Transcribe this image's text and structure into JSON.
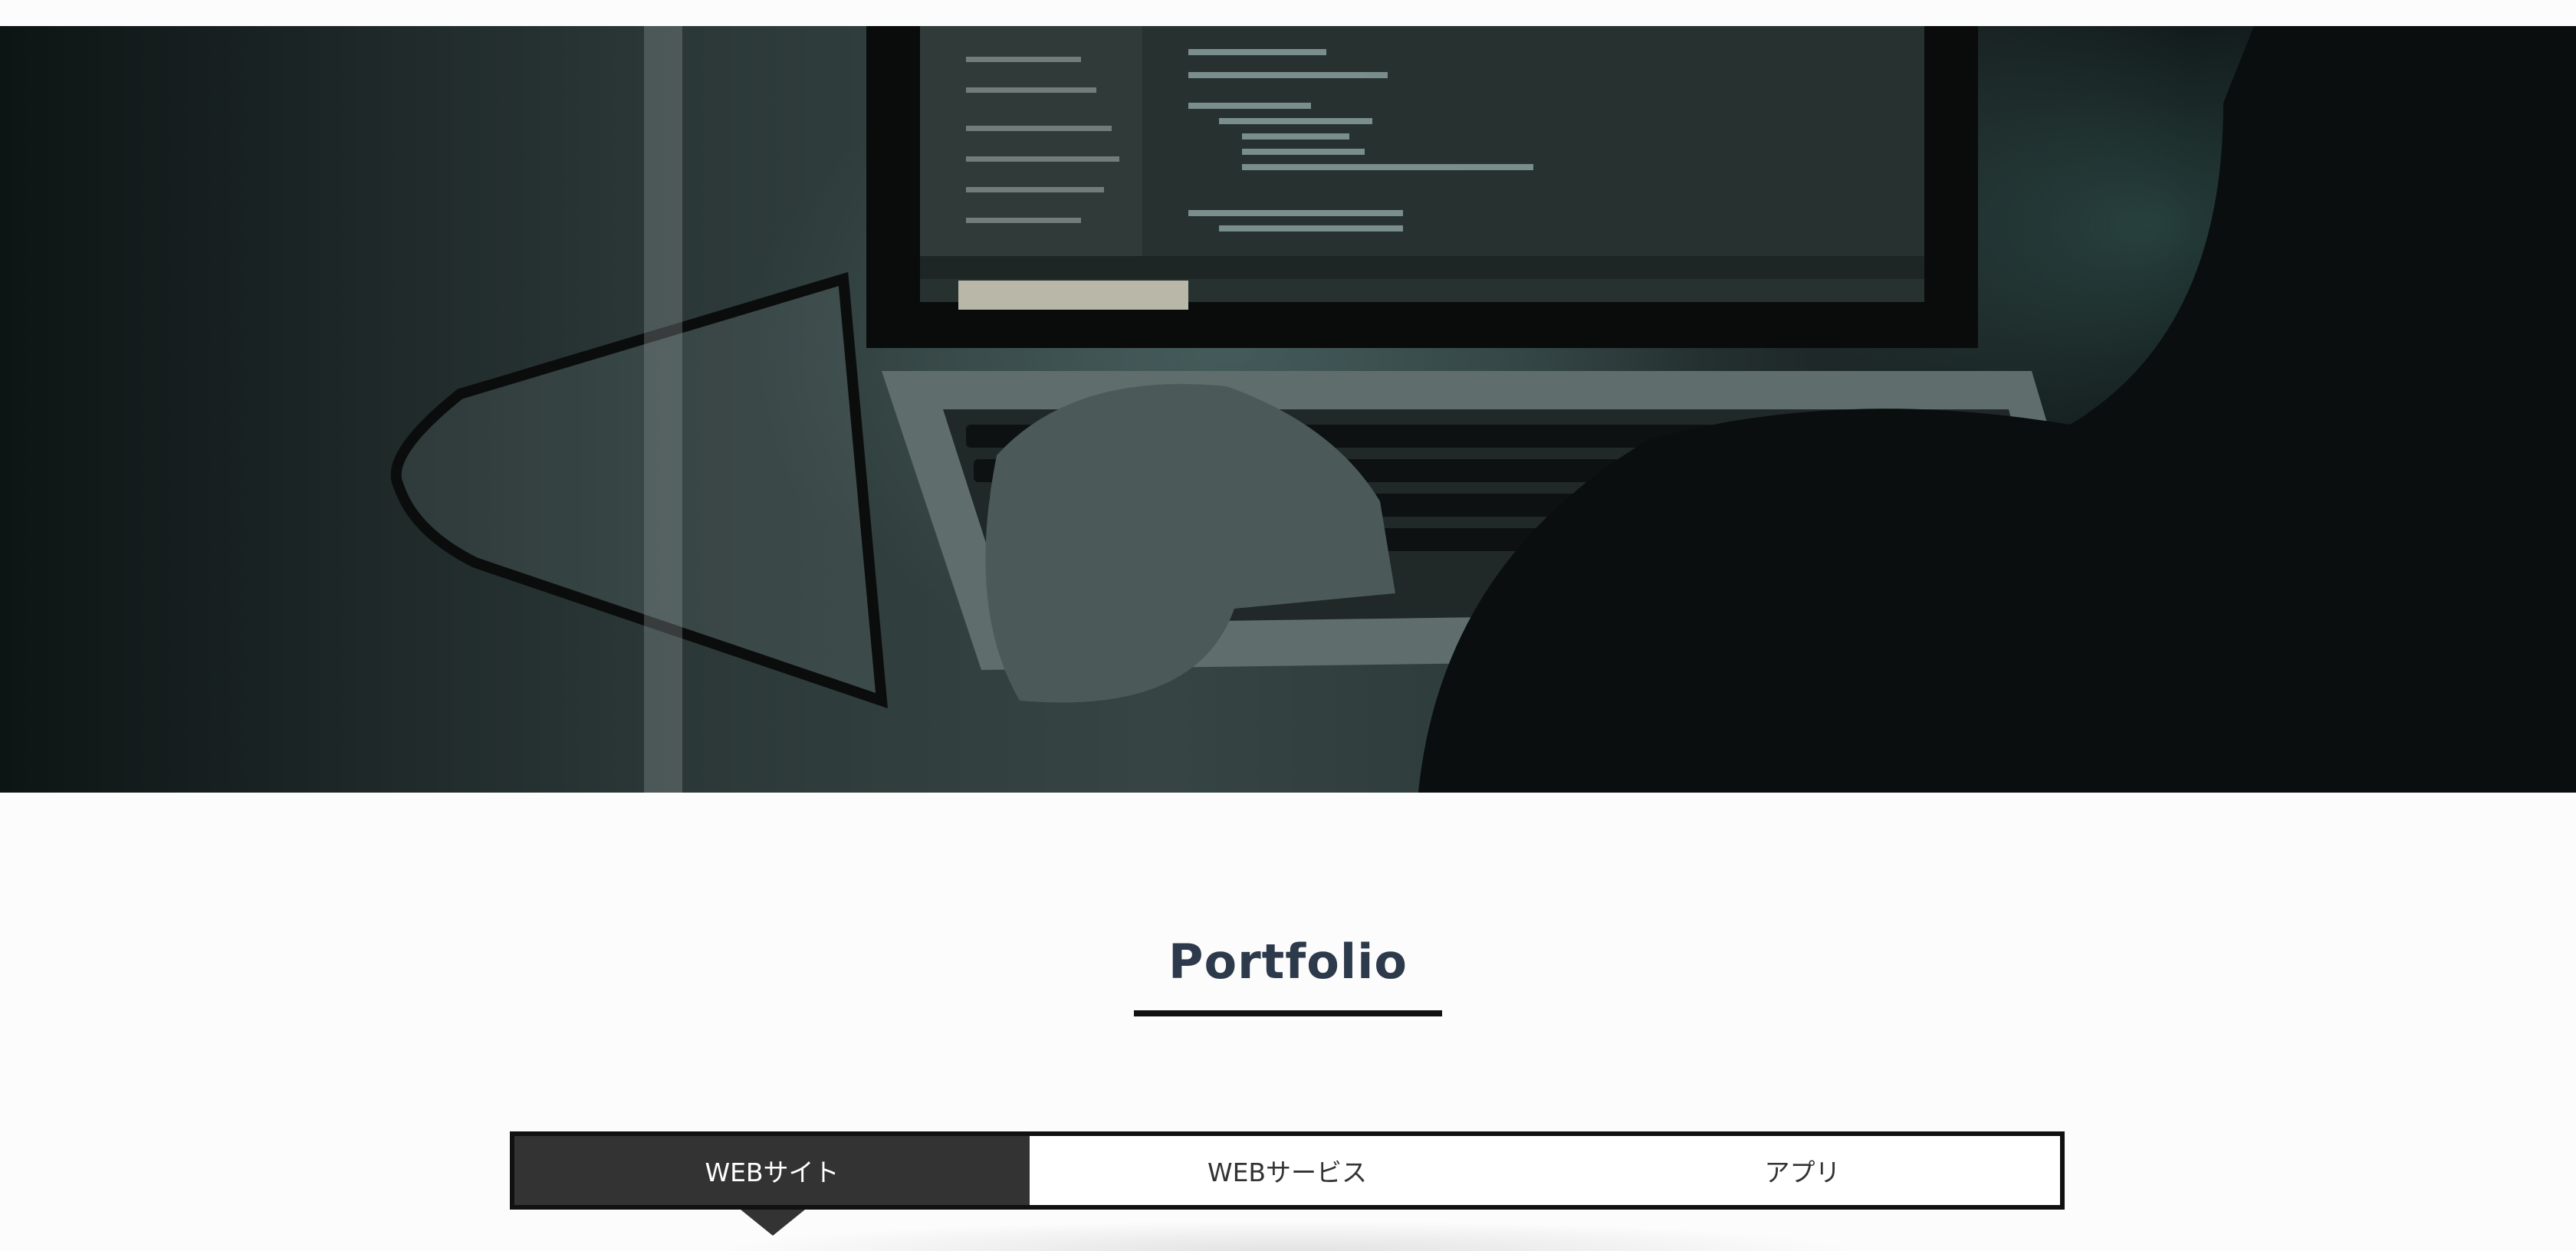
{
  "hero": {
    "image": "developer-typing-on-laptop-code-editor"
  },
  "section": {
    "title": "Portfolio"
  },
  "tabs": [
    {
      "label": "WEBサイト",
      "active": true
    },
    {
      "label": "WEBサービス",
      "active": false
    },
    {
      "label": "アプリ",
      "active": false
    }
  ],
  "colors": {
    "title": "#2d3a4b",
    "active_tab_bg": "#333333",
    "tab_border": "#111111"
  }
}
